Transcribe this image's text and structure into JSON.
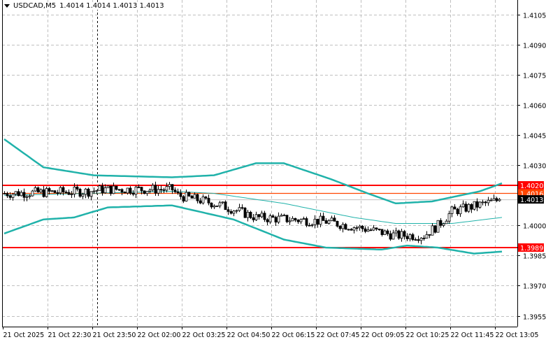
{
  "header": {
    "symbol": "USDCAD,M5",
    "quote": "1.4014 1.4014 1.4013 1.4013"
  },
  "colors": {
    "grid": "#c0c0c0",
    "band": "#20b2aa",
    "level": "#ff0000",
    "level_orange": "#ff4500",
    "candle": "#000000"
  },
  "chart_data": {
    "type": "candlestick",
    "title": "USDCAD,M5",
    "ylim": [
      1.395,
      1.4112
    ],
    "y_ticks": [
      "1.4105",
      "1.4090",
      "1.4075",
      "1.4060",
      "1.4045",
      "1.4030",
      "1.4000",
      "1.3985",
      "1.3970",
      "1.3955"
    ],
    "x_ticks": [
      "21 Oct 2025",
      "21 Oct 22:30",
      "21 Oct 23:50",
      "22 Oct 02:00",
      "22 Oct 03:25",
      "22 Oct 04:50",
      "22 Oct 06:15",
      "22 Oct 07:45",
      "22 Oct 09:05",
      "22 Oct 10:25",
      "22 Oct 11:45",
      "22 Oct 13:05"
    ],
    "candle_count": 178,
    "close_keypoints": [
      [
        0,
        1.4016
      ],
      [
        30,
        1.4017
      ],
      [
        35,
        1.4018
      ],
      [
        60,
        1.4018
      ],
      [
        62,
        1.4015
      ],
      [
        75,
        1.4011
      ],
      [
        82,
        1.4008
      ],
      [
        90,
        1.4004
      ],
      [
        115,
        1.4002
      ],
      [
        130,
        1.3998
      ],
      [
        140,
        1.3995
      ],
      [
        150,
        1.3995
      ],
      [
        155,
        1.4
      ],
      [
        160,
        1.4007
      ],
      [
        175,
        1.4012
      ],
      [
        177,
        1.4013
      ]
    ],
    "bands": {
      "upper": [
        [
          0,
          1.4043
        ],
        [
          14,
          1.4029
        ],
        [
          32,
          1.4025
        ],
        [
          60,
          1.4024
        ],
        [
          75,
          1.4025
        ],
        [
          90,
          1.4031
        ],
        [
          100,
          1.4031
        ],
        [
          117,
          1.4023
        ],
        [
          130,
          1.4016
        ],
        [
          140,
          1.4011
        ],
        [
          153,
          1.4012
        ],
        [
          170,
          1.4017
        ],
        [
          178,
          1.4021
        ]
      ],
      "middle": [
        [
          0,
          1.4015
        ],
        [
          60,
          1.4017
        ],
        [
          75,
          1.4016
        ],
        [
          100,
          1.4011
        ],
        [
          125,
          1.4004
        ],
        [
          140,
          1.4001
        ],
        [
          160,
          1.4001
        ],
        [
          178,
          1.4004
        ]
      ],
      "lower": [
        [
          0,
          1.3996
        ],
        [
          14,
          1.4003
        ],
        [
          25,
          1.4004
        ],
        [
          37,
          1.4009
        ],
        [
          60,
          1.401
        ],
        [
          82,
          1.4003
        ],
        [
          100,
          1.3993
        ],
        [
          115,
          1.3989
        ],
        [
          135,
          1.3988
        ],
        [
          144,
          1.399
        ],
        [
          155,
          1.3989
        ],
        [
          168,
          1.3986
        ],
        [
          178,
          1.3987
        ]
      ]
    },
    "levels": [
      {
        "price": 1.402,
        "label": "1.4020",
        "color": "#ff0000"
      },
      {
        "price": 1.4016,
        "label": "1.4016",
        "color": "#ff4500"
      },
      {
        "price": 1.3989,
        "label": "1.3989",
        "color": "#ff0000"
      }
    ],
    "current_price": {
      "price": 1.4013,
      "label": "1.4013"
    },
    "period_separator_tick": 2
  }
}
